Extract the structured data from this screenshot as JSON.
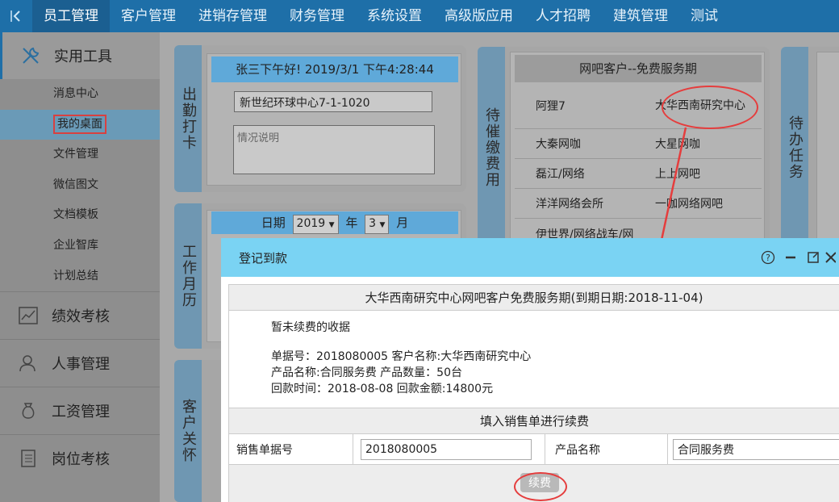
{
  "nav": {
    "back_icon": "chevron-left-icon",
    "items": [
      "员工管理",
      "客户管理",
      "进销存管理",
      "财务管理",
      "系统设置",
      "高级版应用",
      "人才招聘",
      "建筑管理",
      "测试"
    ]
  },
  "sidebar": {
    "head": {
      "label": "实用工具",
      "icon": "tools-icon"
    },
    "subitems": [
      "消息中心",
      "我的桌面",
      "文件管理",
      "微信图文",
      "文档模板",
      "企业智库",
      "计划总结"
    ],
    "groups": [
      {
        "label": "绩效考核",
        "icon": "chart-icon"
      },
      {
        "label": "人事管理",
        "icon": "person-icon"
      },
      {
        "label": "工资管理",
        "icon": "money-bag-icon"
      },
      {
        "label": "岗位考核",
        "icon": "document-icon"
      }
    ]
  },
  "attendance": {
    "tab": "出勤打卡",
    "greeting": "张三下午好!  2019/3/1 下午4:28:44",
    "location_value": "新世纪环球中心7-1-1020",
    "note_placeholder": "情况说明"
  },
  "calendar": {
    "tab": "工作月历",
    "date_label": "日期",
    "year_value": "2019",
    "year_unit": "年",
    "month_value": "3",
    "month_unit": "月"
  },
  "customer_care": {
    "tab": "客户关怀"
  },
  "pending_fee": {
    "tab": "待催缴费用",
    "header": "网吧客户--免费服务期",
    "rows": [
      [
        "阿狸7",
        "大华西南研究中心"
      ],
      [
        "大秦网咖",
        "大星网咖"
      ],
      [
        "磊江/网络",
        "上上网吧"
      ],
      [
        "洋洋网络会所",
        "一咖网络网吧"
      ],
      [
        "伊世界/网络战车/网",
        ""
      ]
    ]
  },
  "todo": {
    "tab": "待办任务"
  },
  "dialog": {
    "title": "登记到款",
    "icons": [
      "help-icon",
      "minimize-icon",
      "maximize-icon",
      "close-icon"
    ],
    "heading": "大华西南研究中心网吧客户免费服务期(到期日期:2018-11-04)",
    "receipt_status": "暂未续费的收据",
    "receipt_line1": "单据号：2018080005    客户名称:大华西南研究中心",
    "receipt_line2": "产品名称:合同服务费    产品数量：50台",
    "receipt_line3": "回款时间：2018-08-08    回款金额:14800元",
    "renew_heading": "填入销售单进行续费",
    "order_no_label": "销售单据号",
    "order_no_value": "2018080005",
    "product_label": "产品名称",
    "product_value": "合同服务费",
    "renew_button": "续费"
  },
  "colors": {
    "nav": "#1e6fa8",
    "accent_blue": "#5fa9d9",
    "dialog_header": "#7ad3f3",
    "highlight_red": "#e53d3d"
  }
}
